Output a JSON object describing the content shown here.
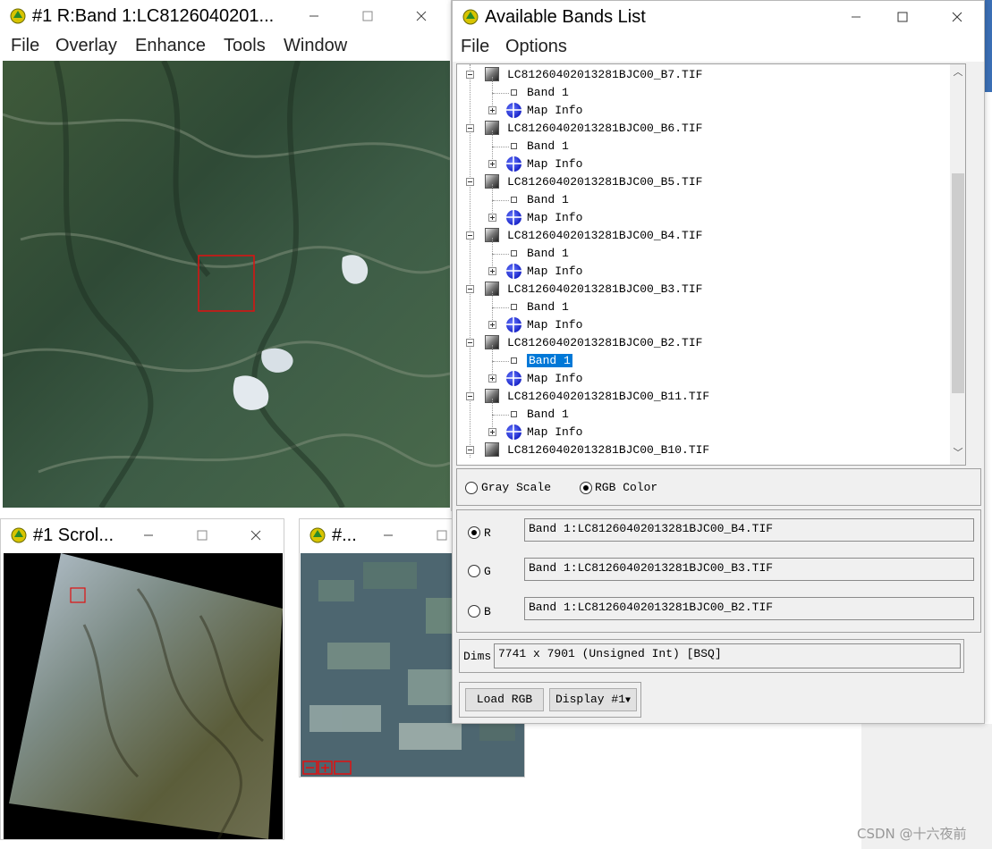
{
  "main_window": {
    "title": "#1 R:Band 1:LC8126040201...",
    "menu": [
      "File",
      "Overlay",
      "Enhance",
      "Tools",
      "Window"
    ]
  },
  "scroll_window": {
    "title": "#1 Scrol..."
  },
  "zoom_window": {
    "title": "#..."
  },
  "bands_window": {
    "title": "Available Bands List",
    "menu": [
      "File",
      "Options"
    ],
    "tree": [
      {
        "file": "LC81260402013281BJC00_B7.TIF",
        "band": "Band 1",
        "mapinfo": "Map Info"
      },
      {
        "file": "LC81260402013281BJC00_B6.TIF",
        "band": "Band 1",
        "mapinfo": "Map Info"
      },
      {
        "file": "LC81260402013281BJC00_B5.TIF",
        "band": "Band 1",
        "mapinfo": "Map Info"
      },
      {
        "file": "LC81260402013281BJC00_B4.TIF",
        "band": "Band 1",
        "mapinfo": "Map Info"
      },
      {
        "file": "LC81260402013281BJC00_B3.TIF",
        "band": "Band 1",
        "mapinfo": "Map Info"
      },
      {
        "file": "LC81260402013281BJC00_B2.TIF",
        "band": "Band 1",
        "mapinfo": "Map Info",
        "selected": true
      },
      {
        "file": "LC81260402013281BJC00_B11.TIF",
        "band": "Band 1",
        "mapinfo": "Map Info"
      },
      {
        "file": "LC81260402013281BJC00_B10.TIF"
      }
    ],
    "mode": {
      "gray": "Gray Scale",
      "rgb": "RGB Color",
      "selected": "rgb"
    },
    "channels": [
      {
        "label": "R",
        "value": "Band 1:LC81260402013281BJC00_B4.TIF",
        "checked": true
      },
      {
        "label": "G",
        "value": "Band 1:LC81260402013281BJC00_B3.TIF",
        "checked": false
      },
      {
        "label": "B",
        "value": "Band 1:LC81260402013281BJC00_B2.TIF",
        "checked": false
      }
    ],
    "dims_label": "Dims",
    "dims_value": "7741 x 7901 (Unsigned Int) [BSQ]",
    "load_button": "Load RGB",
    "display_button": "Display #1"
  },
  "watermark": "CSDN @十六夜前",
  "colors": {
    "selection": "#0078d7",
    "box": "#e01010"
  },
  "icons": [
    "envi-app-icon",
    "minimize-icon",
    "maximize-icon",
    "close-icon",
    "file-image-icon",
    "band-icon",
    "globe-icon",
    "expand-icon",
    "collapse-icon"
  ]
}
